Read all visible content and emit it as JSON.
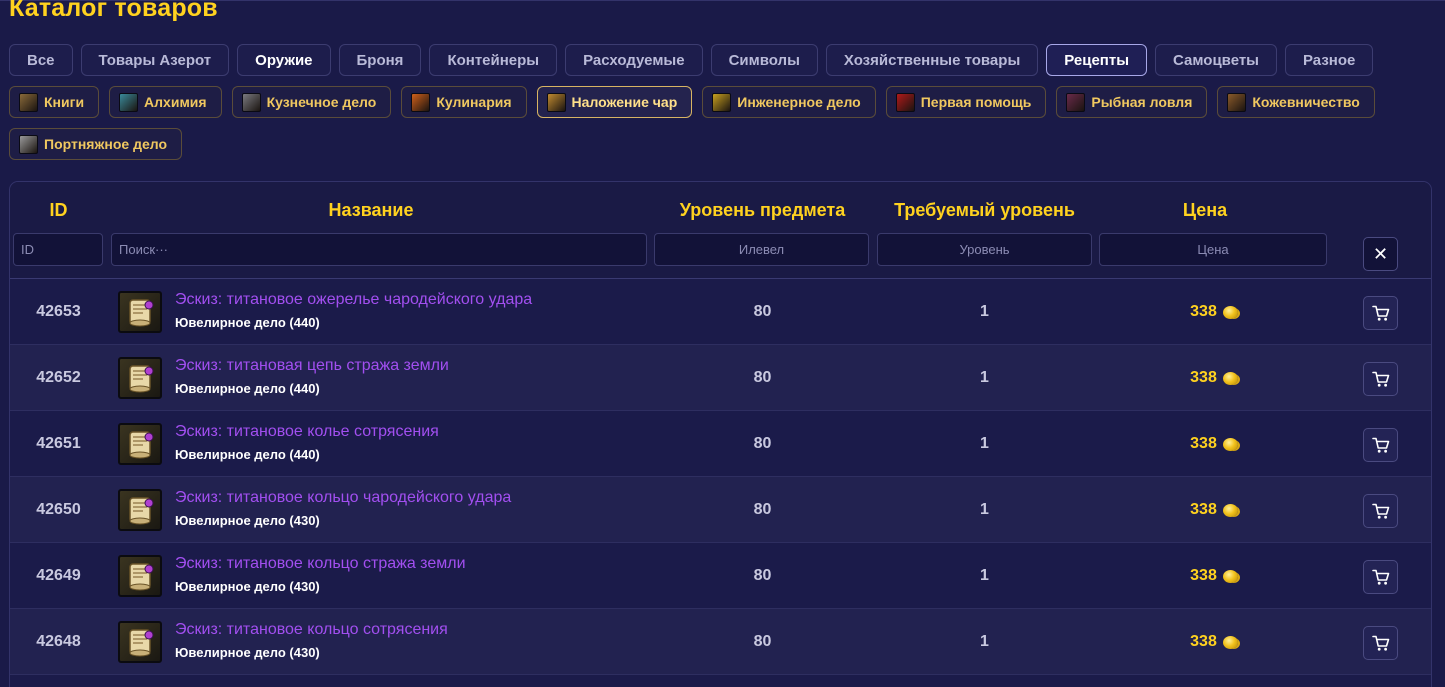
{
  "page": {
    "title": "Каталог товаров"
  },
  "categories": [
    {
      "label": "Все",
      "style": "normal"
    },
    {
      "label": "Товары Азерот",
      "style": "normal"
    },
    {
      "label": "Оружие",
      "style": "bright"
    },
    {
      "label": "Броня",
      "style": "normal"
    },
    {
      "label": "Контейнеры",
      "style": "normal"
    },
    {
      "label": "Расходуемые",
      "style": "normal"
    },
    {
      "label": "Символы",
      "style": "normal"
    },
    {
      "label": "Хозяйственные товары",
      "style": "normal"
    },
    {
      "label": "Рецепты",
      "style": "active"
    },
    {
      "label": "Самоцветы",
      "style": "normal"
    },
    {
      "label": "Разное",
      "style": "normal"
    }
  ],
  "professions": [
    {
      "label": "Книги",
      "icon": "book-icon",
      "color": "#8a6a3a",
      "active": false
    },
    {
      "label": "Алхимия",
      "icon": "flask-icon",
      "color": "#3a8a9a",
      "active": false
    },
    {
      "label": "Кузнечное дело",
      "icon": "anvil-icon",
      "color": "#7a7a80",
      "active": false
    },
    {
      "label": "Кулинария",
      "icon": "cooking-pot-icon",
      "color": "#d0601a",
      "active": false
    },
    {
      "label": "Наложение чар",
      "icon": "enchanting-scroll-icon",
      "color": "#c08a30",
      "active": true
    },
    {
      "label": "Инженерное дело",
      "icon": "gear-icon",
      "color": "#c8a020",
      "active": false
    },
    {
      "label": "Первая помощь",
      "icon": "first-aid-icon",
      "color": "#b01a1a",
      "active": false
    },
    {
      "label": "Рыбная ловля",
      "icon": "fishing-rod-icon",
      "color": "#6a2a4a",
      "active": false
    },
    {
      "label": "Кожевничество",
      "icon": "leather-icon",
      "color": "#8a5a2a",
      "active": false
    },
    {
      "label": "Портняжное дело",
      "icon": "spool-icon",
      "color": "#9a9a9a",
      "active": false
    }
  ],
  "table": {
    "headers": {
      "id": "ID",
      "name": "Название",
      "item_level": "Уровень предмета",
      "required_level": "Требуемый уровень",
      "price": "Цена"
    },
    "filters": {
      "id_placeholder": "ID",
      "search_placeholder": "Поиск···",
      "ilvl_placeholder": "Илевел",
      "level_placeholder": "Уровень",
      "price_placeholder": "Цена",
      "clear_label": "✕"
    },
    "rows": [
      {
        "id": "42653",
        "name": "Эскиз: титановое ожерелье чародейского удара",
        "sub": "Ювелирное дело (440)",
        "ilvl": "80",
        "req": "1",
        "price": "338"
      },
      {
        "id": "42652",
        "name": "Эскиз: титановая цепь стража земли",
        "sub": "Ювелирное дело (440)",
        "ilvl": "80",
        "req": "1",
        "price": "338"
      },
      {
        "id": "42651",
        "name": "Эскиз: титановое колье сотрясения",
        "sub": "Ювелирное дело (440)",
        "ilvl": "80",
        "req": "1",
        "price": "338"
      },
      {
        "id": "42650",
        "name": "Эскиз: титановое кольцо чародейского удара",
        "sub": "Ювелирное дело (430)",
        "ilvl": "80",
        "req": "1",
        "price": "338"
      },
      {
        "id": "42649",
        "name": "Эскиз: титановое кольцо стража земли",
        "sub": "Ювелирное дело (430)",
        "ilvl": "80",
        "req": "1",
        "price": "338"
      },
      {
        "id": "42648",
        "name": "Эскиз: титановое кольцо сотрясения",
        "sub": "Ювелирное дело (430)",
        "ilvl": "80",
        "req": "1",
        "price": "338"
      }
    ]
  },
  "colors": {
    "accent": "#ffd21f",
    "item_name": "#a24ff0",
    "background": "#1a1a48"
  }
}
